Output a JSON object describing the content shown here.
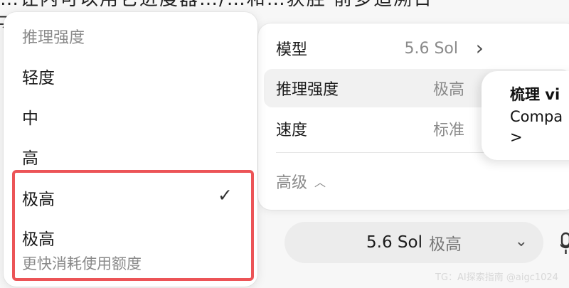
{
  "background": {
    "line1": "…让内可以用它进度器…/…和…获胜 前多追溯日",
    "line2": "只"
  },
  "settings": {
    "model_label": "模型",
    "model_value": "5.6 Sol",
    "reasoning_label": "推理强度",
    "reasoning_value": "极高",
    "speed_label": "速度",
    "speed_value": "标准",
    "advanced_label": "高级"
  },
  "tooltip": {
    "title": "梳理 vi",
    "body": "Compa",
    "arrow": ">"
  },
  "dropdown": {
    "header": "推理强度",
    "items": [
      "轻度",
      "中",
      "高",
      "极高",
      "极高"
    ],
    "selected_index": 3,
    "subtitle": "更快消耗使用额度",
    "highlight_color": "#ec5457"
  },
  "model_pill": {
    "model": "5.6 Sol",
    "level": "极高"
  },
  "watermark": "TG：AI探索指南 @aigc1024"
}
